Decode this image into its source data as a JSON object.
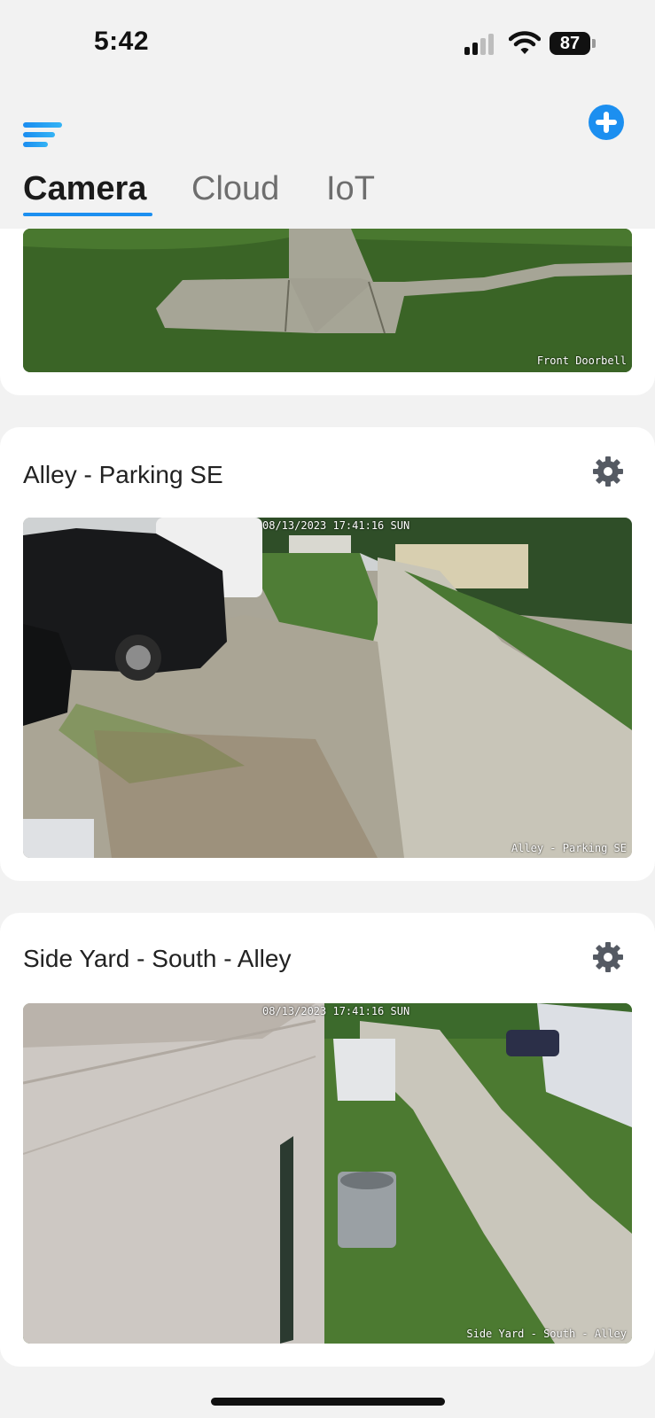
{
  "status_bar": {
    "time": "5:42",
    "battery": "87"
  },
  "tabs": [
    {
      "label": "Camera",
      "active": true
    },
    {
      "label": "Cloud",
      "active": false
    },
    {
      "label": "IoT",
      "active": false
    }
  ],
  "cameras": [
    {
      "name": "Front Doorbell",
      "osd_name": "Front Doorbell"
    },
    {
      "name": "Alley - Parking SE",
      "osd_time": "08/13/2023 17:41:16 SUN",
      "osd_name": "Alley - Parking SE"
    },
    {
      "name": "Side Yard - South - Alley",
      "osd_time": "08/13/2023 17:41:16 SUN",
      "osd_name": "Side Yard - South - Alley"
    }
  ],
  "colors": {
    "accent": "#1c8ff0",
    "background": "#f2f2f2",
    "card": "#ffffff"
  },
  "icons": {
    "menu": "menu-icon",
    "add": "add-icon",
    "settings": "gear-icon",
    "signal": "signal-icon",
    "wifi": "wifi-icon",
    "battery": "battery-icon"
  }
}
